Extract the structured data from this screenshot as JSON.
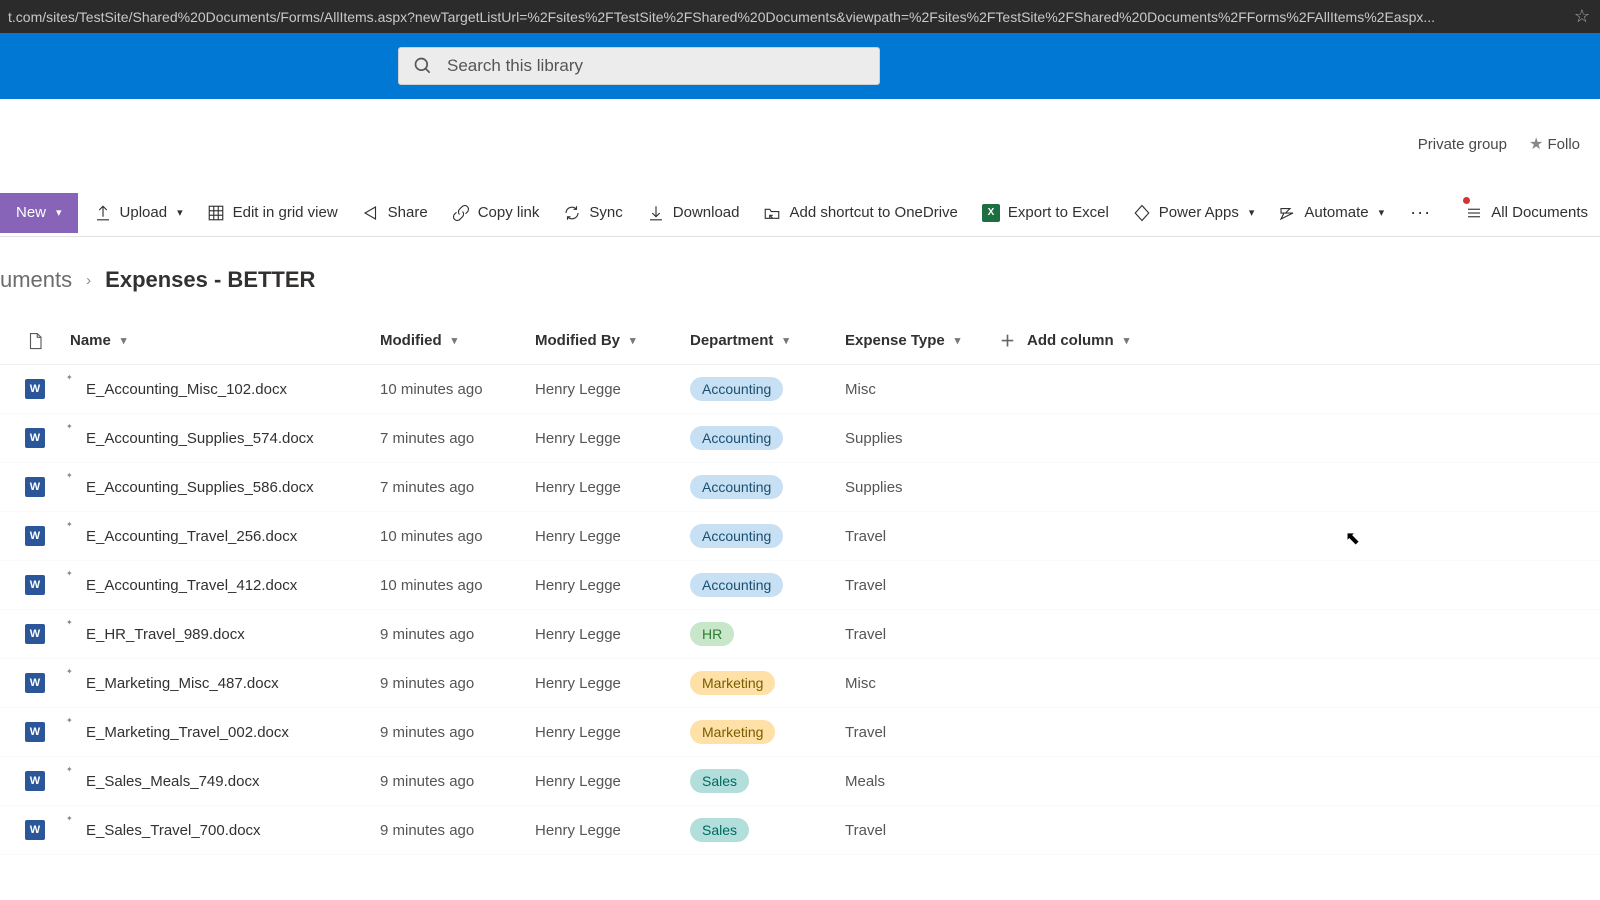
{
  "browser": {
    "url": "t.com/sites/TestSite/Shared%20Documents/Forms/AllItems.aspx?newTargetListUrl=%2Fsites%2FTestSite%2FShared%20Documents&viewpath=%2Fsites%2FTestSite%2FShared%20Documents%2FForms%2FAllItems%2Easpx..."
  },
  "search": {
    "placeholder": "Search this library"
  },
  "siteHeader": {
    "group": "Private group",
    "follow": "Follo"
  },
  "commands": {
    "new": "New",
    "upload": "Upload",
    "editGrid": "Edit in grid view",
    "share": "Share",
    "copyLink": "Copy link",
    "sync": "Sync",
    "download": "Download",
    "shortcut": "Add shortcut to OneDrive",
    "export": "Export to Excel",
    "powerApps": "Power Apps",
    "automate": "Automate",
    "view": "All Documents"
  },
  "breadcrumb": {
    "parent": "uments",
    "current": "Expenses - BETTER"
  },
  "columns": {
    "name": "Name",
    "modified": "Modified",
    "modifiedBy": "Modified By",
    "department": "Department",
    "expenseType": "Expense Type",
    "add": "Add column"
  },
  "rows": [
    {
      "name": "E_Accounting_Misc_102.docx",
      "modified": "10 minutes ago",
      "modifiedBy": "Henry Legge",
      "department": "Accounting",
      "expenseType": "Misc"
    },
    {
      "name": "E_Accounting_Supplies_574.docx",
      "modified": "7 minutes ago",
      "modifiedBy": "Henry Legge",
      "department": "Accounting",
      "expenseType": "Supplies"
    },
    {
      "name": "E_Accounting_Supplies_586.docx",
      "modified": "7 minutes ago",
      "modifiedBy": "Henry Legge",
      "department": "Accounting",
      "expenseType": "Supplies"
    },
    {
      "name": "E_Accounting_Travel_256.docx",
      "modified": "10 minutes ago",
      "modifiedBy": "Henry Legge",
      "department": "Accounting",
      "expenseType": "Travel"
    },
    {
      "name": "E_Accounting_Travel_412.docx",
      "modified": "10 minutes ago",
      "modifiedBy": "Henry Legge",
      "department": "Accounting",
      "expenseType": "Travel"
    },
    {
      "name": "E_HR_Travel_989.docx",
      "modified": "9 minutes ago",
      "modifiedBy": "Henry Legge",
      "department": "HR",
      "expenseType": "Travel"
    },
    {
      "name": "E_Marketing_Misc_487.docx",
      "modified": "9 minutes ago",
      "modifiedBy": "Henry Legge",
      "department": "Marketing",
      "expenseType": "Misc"
    },
    {
      "name": "E_Marketing_Travel_002.docx",
      "modified": "9 minutes ago",
      "modifiedBy": "Henry Legge",
      "department": "Marketing",
      "expenseType": "Travel"
    },
    {
      "name": "E_Sales_Meals_749.docx",
      "modified": "9 minutes ago",
      "modifiedBy": "Henry Legge",
      "department": "Sales",
      "expenseType": "Meals"
    },
    {
      "name": "E_Sales_Travel_700.docx",
      "modified": "9 minutes ago",
      "modifiedBy": "Henry Legge",
      "department": "Sales",
      "expenseType": "Travel"
    }
  ]
}
